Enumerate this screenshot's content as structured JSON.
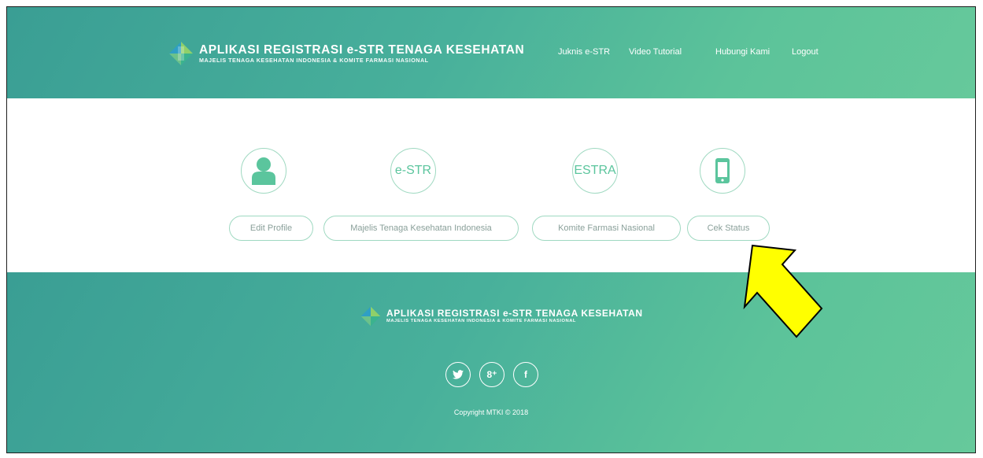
{
  "header": {
    "brand_title": "APLIKASI REGISTRASI e-STR TENAGA KESEHATAN",
    "brand_subtitle": "MAJELIS TENAGA KESEHATAN INDONESIA & KOMITE FARMASI NASIONAL",
    "nav": [
      {
        "label": "Juknis e-STR"
      },
      {
        "label": "Video Tutorial"
      },
      {
        "label": "Hubungi Kami"
      },
      {
        "label": "Logout"
      }
    ]
  },
  "tiles": [
    {
      "icon": "user-icon",
      "circle_text": "",
      "label": "Edit Profile"
    },
    {
      "icon": "",
      "circle_text": "e-STR",
      "label": "Majelis Tenaga Kesehatan Indonesia"
    },
    {
      "icon": "",
      "circle_text": "ESTRA",
      "label": "Komite Farmasi Nasional"
    },
    {
      "icon": "mobile-phone-icon",
      "circle_text": "",
      "label": "Cek Status"
    }
  ],
  "footer": {
    "brand_title": "APLIKASI REGISTRASI e-STR TENAGA KESEHATAN",
    "brand_subtitle": "MAJELIS TENAGA KESEHATAN INDONESIA & KOMITE FARMASI NASIONAL",
    "social": [
      {
        "icon": "twitter-icon"
      },
      {
        "icon": "google-plus-icon",
        "glyph": "8⁺"
      },
      {
        "icon": "facebook-icon",
        "glyph": "f"
      }
    ],
    "copyright": "Copyright MTKI © 2018"
  },
  "colors": {
    "accent": "#5bc59d",
    "header_gradient_start": "#3a9e94",
    "header_gradient_end": "#66c99b",
    "annotation_arrow": "#ffff00"
  }
}
